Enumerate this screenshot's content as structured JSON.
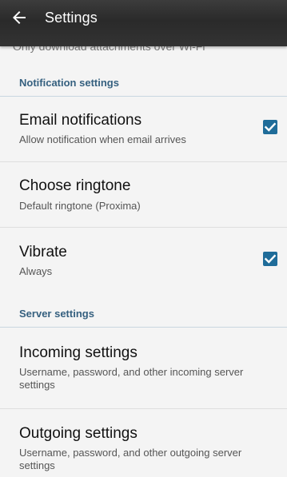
{
  "app_bar": {
    "title": "Settings",
    "back_icon": "arrow-back-icon"
  },
  "clipped_text": "Only download attachments over Wi-Fi",
  "sections": {
    "notification": {
      "header": "Notification settings",
      "items": {
        "email_notifications": {
          "title": "Email notifications",
          "summary": "Allow notification when email arrives",
          "checked": true
        },
        "choose_ringtone": {
          "title": "Choose ringtone",
          "summary": "Default ringtone (Proxima)"
        },
        "vibrate": {
          "title": "Vibrate",
          "summary": "Always",
          "checked": true
        }
      }
    },
    "server": {
      "header": "Server settings",
      "items": {
        "incoming": {
          "title": "Incoming settings",
          "summary": "Username, password, and other incoming server settings"
        },
        "outgoing": {
          "title": "Outgoing settings",
          "summary": "Username, password, and other outgoing server settings"
        }
      }
    }
  },
  "colors": {
    "accent": "#1f6c99",
    "section_header": "#35607f",
    "app_bar": "#2e2e2e"
  }
}
